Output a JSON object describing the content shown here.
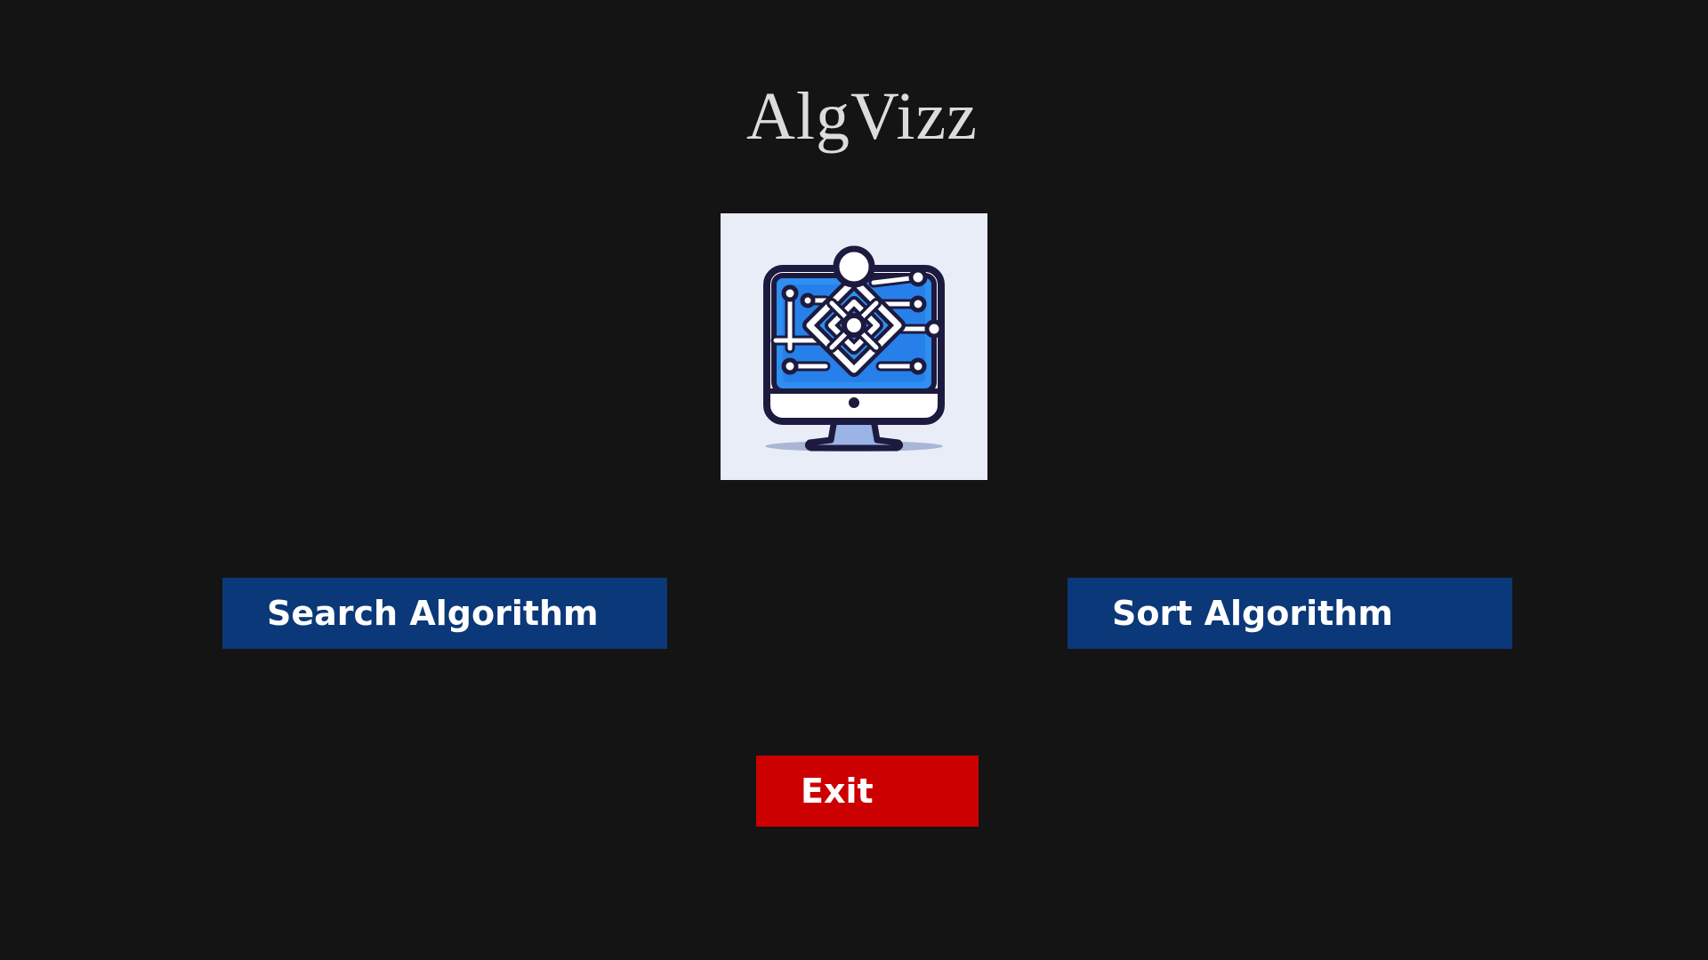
{
  "app": {
    "title": "AlgVizz"
  },
  "logo": {
    "icon": "computer-monitor-algorithm-icon"
  },
  "buttons": {
    "search_label": "Search Algorithm",
    "sort_label": "Sort Algorithm",
    "exit_label": "Exit"
  },
  "colors": {
    "background": "#141414",
    "primary_button": "#0b3878",
    "exit_button": "#cc0000",
    "title_text": "#dcdcdc",
    "logo_background": "#e8edf8"
  }
}
